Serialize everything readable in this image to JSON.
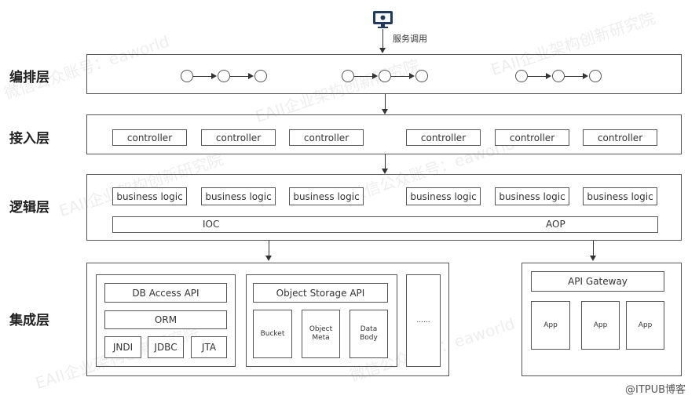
{
  "top": {
    "icon": "monitor-gear-icon",
    "label": "服务调用"
  },
  "layers": {
    "orchestration": {
      "label": "编排层"
    },
    "access": {
      "label": "接入层",
      "controllers": [
        "controller",
        "controller",
        "controller",
        "controller",
        "controller",
        "controller"
      ]
    },
    "logic": {
      "label": "逻辑层",
      "items": [
        "business logic",
        "business logic",
        "business logic",
        "business logic",
        "business logic",
        "business logic"
      ],
      "ioc": "IOC",
      "aop": "AOP"
    },
    "integration": {
      "label": "集成层",
      "db": {
        "api": "DB Access API",
        "orm": "ORM",
        "items": [
          "JNDI",
          "JDBC",
          "JTA"
        ]
      },
      "object": {
        "api": "Object Storage API",
        "items": [
          "Bucket",
          "Object\nMeta",
          "Data\nBody"
        ]
      },
      "more": "......",
      "gateway": {
        "label": "API Gateway",
        "apps": [
          "App",
          "App",
          "App"
        ]
      }
    }
  },
  "watermarks": [
    "微信公众账号：eaworld",
    "EAII企业架构创新研究院",
    "@ITPUB博客"
  ]
}
